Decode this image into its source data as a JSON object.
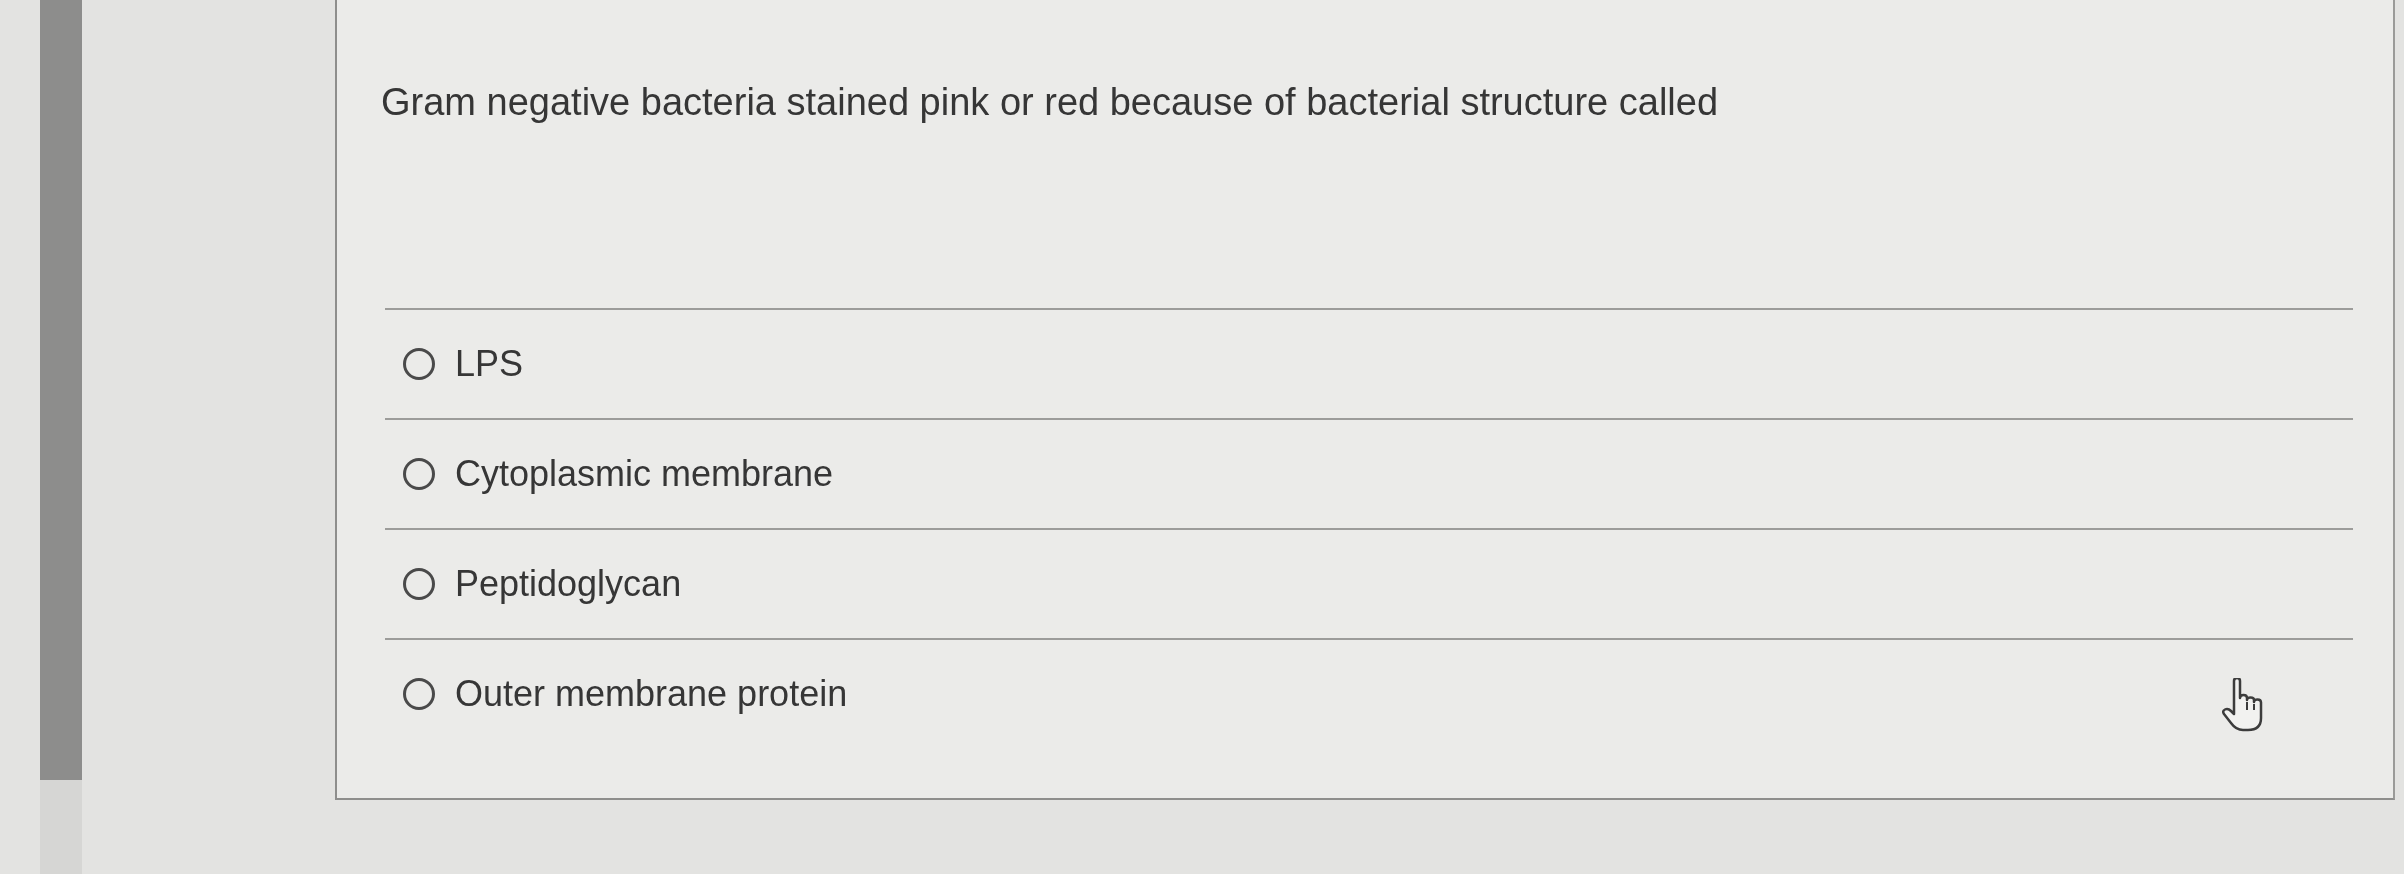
{
  "question": {
    "text": "Gram negative bacteria stained pink or red because of bacterial structure called"
  },
  "options": [
    {
      "label": "LPS",
      "selected": false
    },
    {
      "label": "Cytoplasmic membrane",
      "selected": false
    },
    {
      "label": "Peptidoglycan",
      "selected": false
    },
    {
      "label": "Outer membrane protein",
      "selected": false
    }
  ]
}
